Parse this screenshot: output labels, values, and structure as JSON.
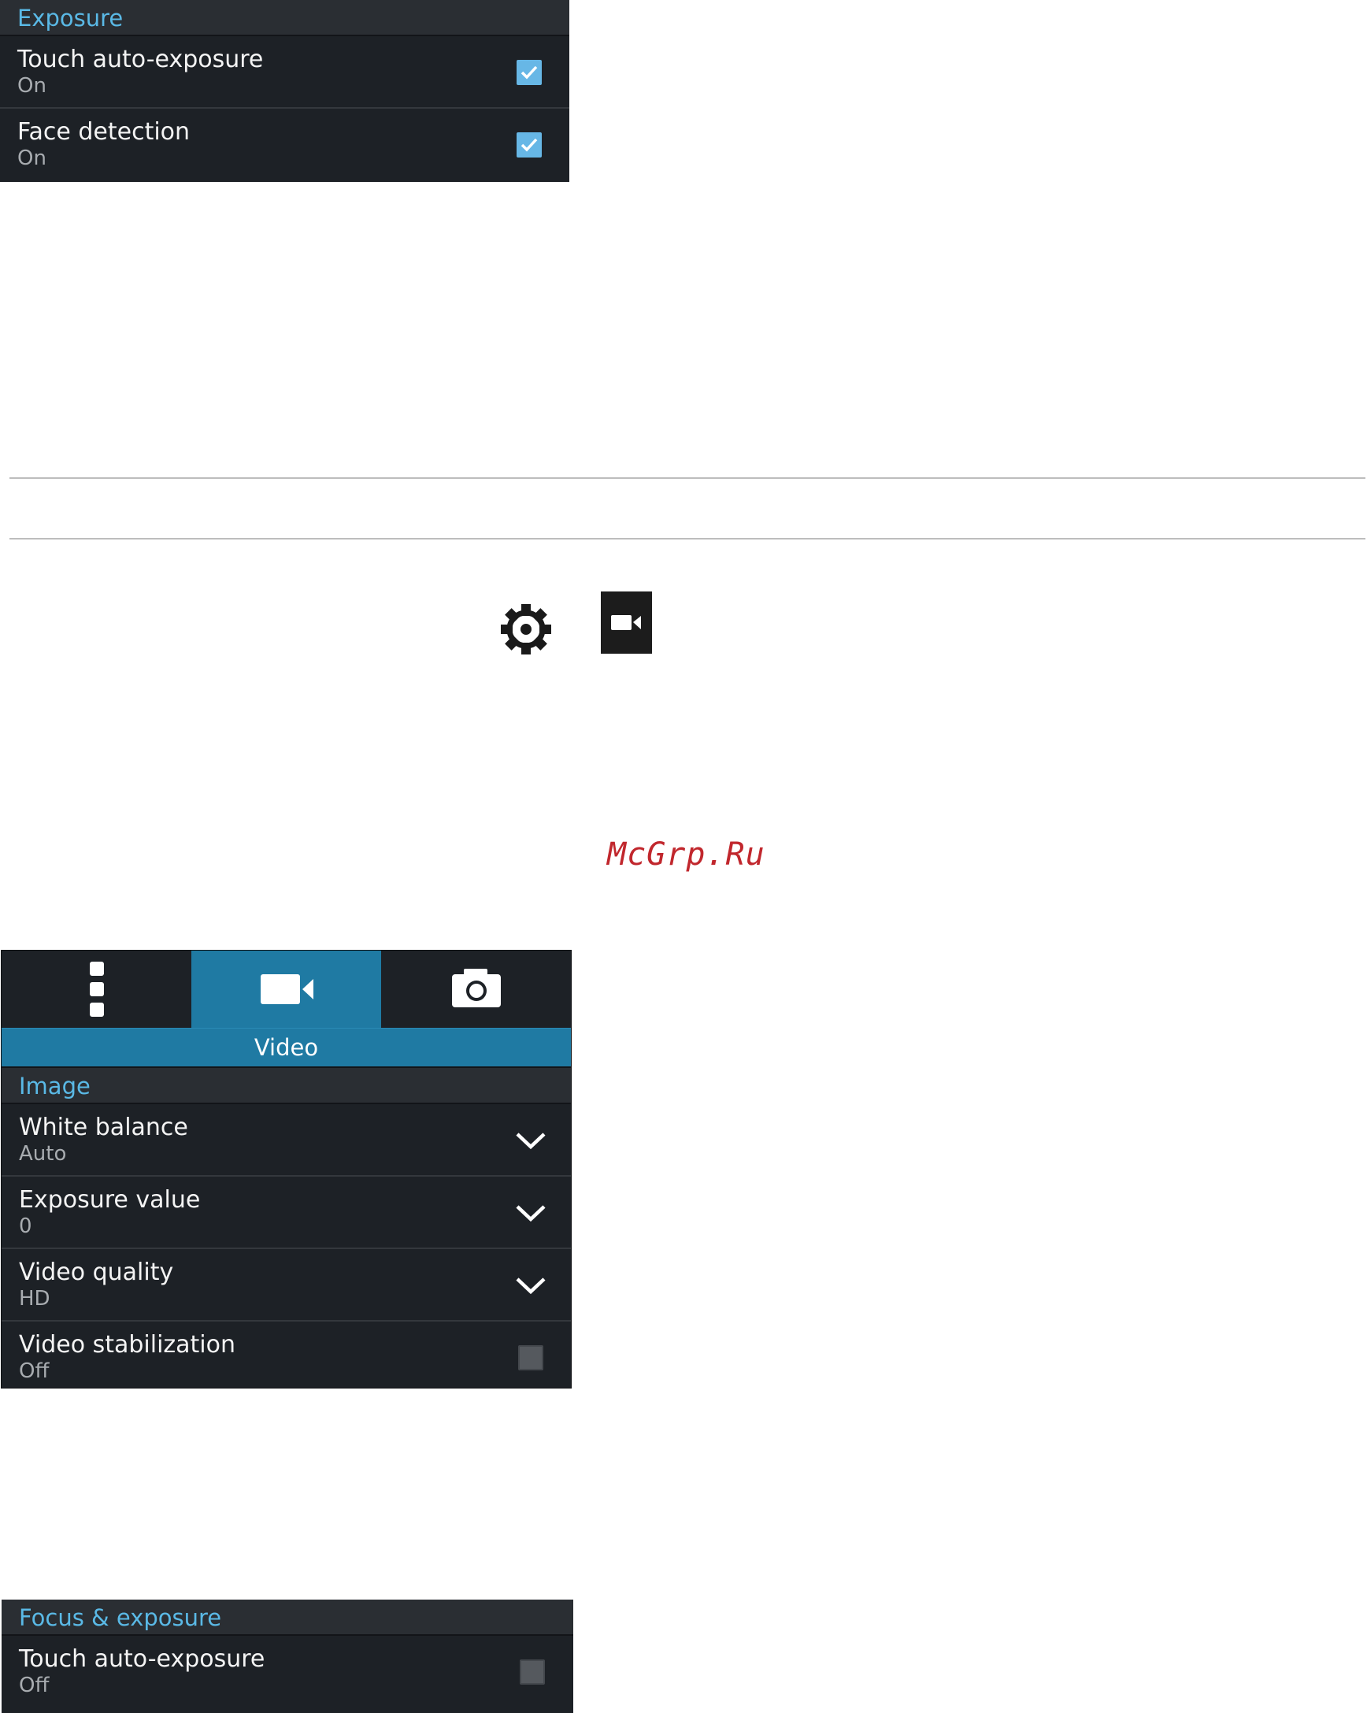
{
  "panel_exposure": {
    "section_title": "Exposure",
    "rows": [
      {
        "title": "Touch auto-exposure",
        "value": "On",
        "control": "checkbox",
        "checked": true
      },
      {
        "title": "Face detection",
        "value": "On",
        "control": "checkbox",
        "checked": true
      }
    ]
  },
  "icons": {
    "settings": "gear-icon",
    "video_mode": "video-camera-icon"
  },
  "watermark": "McGrp.Ru",
  "panel_video": {
    "tabs": [
      {
        "icon": "more-options-icon",
        "active": false
      },
      {
        "icon": "video-camera-icon",
        "active": true
      },
      {
        "icon": "camera-icon",
        "active": false
      }
    ],
    "mode_label": "Video",
    "section_title": "Image",
    "rows": [
      {
        "title": "White balance",
        "value": "Auto",
        "control": "dropdown"
      },
      {
        "title": "Exposure value",
        "value": "0",
        "control": "dropdown"
      },
      {
        "title": "Video quality",
        "value": "HD",
        "control": "dropdown"
      },
      {
        "title": "Video stabilization",
        "value": "Off",
        "control": "checkbox",
        "checked": false
      }
    ]
  },
  "panel_focus": {
    "section_title": "Focus & exposure",
    "rows": [
      {
        "title": "Touch auto-exposure",
        "value": "Off",
        "control": "checkbox",
        "checked": false
      }
    ]
  },
  "colors": {
    "accent": "#5ab9e6",
    "tab_active": "#1f7aa3",
    "panel_bg": "#1d2126",
    "watermark": "#c1272d"
  }
}
